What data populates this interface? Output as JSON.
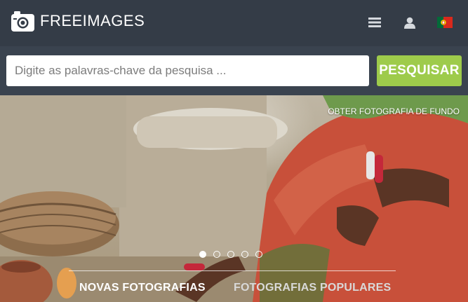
{
  "brand": {
    "name": "FREEIMAGES"
  },
  "nav": {
    "menu_icon": "hamburger-menu",
    "user_icon": "user",
    "language_flag": "portugal-flag"
  },
  "search": {
    "placeholder": "Digite as palavras-chave da pesquisa ...",
    "value": "",
    "button_label": "PESQUISAR"
  },
  "hero": {
    "background_link": "OBTER FOTOGRAFIA DE FUNDO",
    "slides_total": 5,
    "active_slide": 1
  },
  "tabs": [
    {
      "label": "NOVAS FOTOGRAFIAS",
      "active": true
    },
    {
      "label": "FOTOGRAFIAS POPULARES",
      "active": false
    }
  ],
  "colors": {
    "header_bg": "#343c47",
    "search_bg": "#3a434f",
    "accent_green": "#9ecb4b",
    "flag_green": "#046a38",
    "flag_red": "#da291c"
  }
}
